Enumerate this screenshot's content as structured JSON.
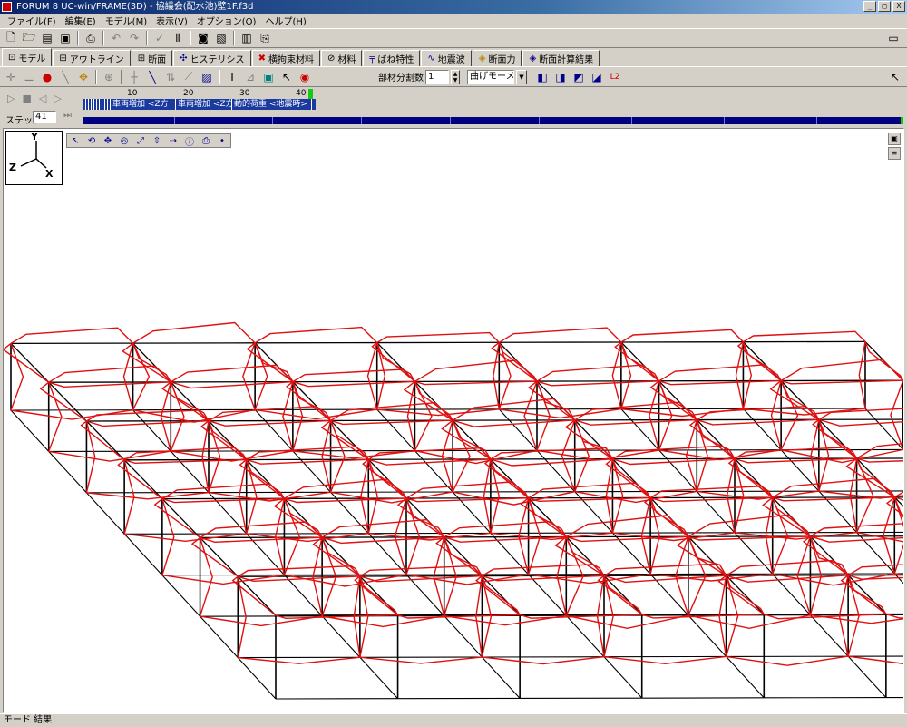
{
  "window": {
    "title": "FORUM 8 UC-win/FRAME(3D) - 協議会(配水池)壁1F.f3d",
    "min_label": "_",
    "max_label": "□",
    "close_label": "X"
  },
  "menu": [
    "ファイル(F)",
    "編集(E)",
    "モデル(M)",
    "表示(V)",
    "オプション(O)",
    "ヘルプ(H)"
  ],
  "tabs": [
    {
      "label": "モデル",
      "icon": "⊡"
    },
    {
      "label": "アウトライン",
      "icon": "⊞"
    },
    {
      "label": "断面",
      "icon": "⊞"
    },
    {
      "label": "ヒステリシス",
      "icon": "✣"
    },
    {
      "label": "横拘束材料",
      "icon": "✖"
    },
    {
      "label": "材料",
      "icon": "⊘"
    },
    {
      "label": "ばね特性",
      "icon": "╤"
    },
    {
      "label": "地震波",
      "icon": "∿"
    },
    {
      "label": "断面力",
      "icon": "◈"
    },
    {
      "label": "断面計算結果",
      "icon": "◈"
    }
  ],
  "toolbar2": {
    "division_label": "部材分割数",
    "division_value": "1",
    "combo_value": "曲げモーメント"
  },
  "animation": {
    "step_label": "ステップ",
    "step_value": "41",
    "ruler": [
      "10",
      "20",
      "30",
      "40"
    ],
    "timeline_cells": [
      "車両増加 <Z方",
      "車両増加 <Z方",
      "動的荷重 <地震時>"
    ]
  },
  "axes": {
    "y": "Y",
    "z": "Z",
    "x": "X"
  },
  "status": {
    "text": "モード 結果"
  },
  "colors": {
    "frame": "#000000",
    "deformed": "#e01010",
    "title_start": "#0a246a",
    "timeline": "#000080"
  }
}
